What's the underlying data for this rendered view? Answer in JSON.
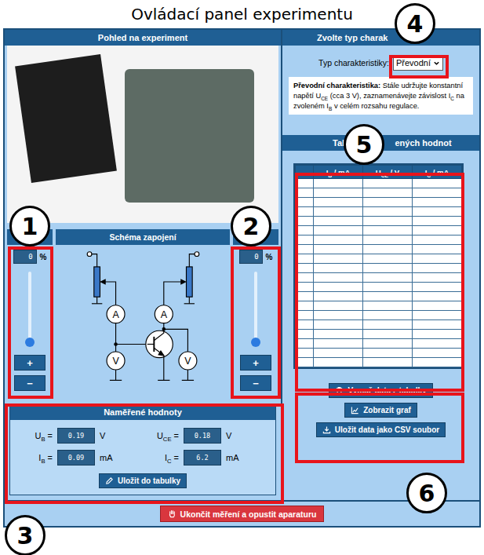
{
  "window": {
    "title": "Ovládací panel experimentu"
  },
  "left": {
    "photo_panel": {
      "title": "Pohled na experiment"
    },
    "schematic": {
      "title": "Schéma zapojení",
      "ammeter_label": "A",
      "voltmeter_label": "V"
    },
    "sliders": [
      {
        "value": "0",
        "unit": "%",
        "level": 0,
        "plus": "+",
        "minus": "−"
      },
      {
        "value": "0",
        "unit": "%",
        "level": 0,
        "plus": "+",
        "minus": "−"
      }
    ],
    "measured": {
      "title": "Naměřené hodnoty",
      "values": [
        {
          "symbol": "U",
          "sub": "B",
          "sign": "=",
          "value": "0.19",
          "unit": "V"
        },
        {
          "symbol": "U",
          "sub": "CE",
          "sign": "=",
          "value": "0.18",
          "unit": "V"
        },
        {
          "symbol": "I",
          "sub": "B",
          "sign": "=",
          "value": "0.09",
          "unit": "mA"
        },
        {
          "symbol": "I",
          "sub": "C",
          "sign": "=",
          "value": "6.2",
          "unit": "mA"
        }
      ],
      "save_button": "Uložit do tabulky"
    }
  },
  "right": {
    "type_panel": {
      "title": "Zvolte typ charak",
      "label": "Typ charakteristiky:",
      "selected": "Převodní",
      "description": {
        "title": "Převodní charakteristika:",
        "parts": [
          {
            "kind": "text",
            "text": "Stále udržujte konstantní napětí U"
          },
          {
            "kind": "sub",
            "text": "CE"
          },
          {
            "kind": "text",
            "text": " (cca 3 V), zaznamenávejte závislost I"
          },
          {
            "kind": "sub",
            "text": "C"
          },
          {
            "kind": "text",
            "text": " na zvoleném I"
          },
          {
            "kind": "sub",
            "text": "B"
          },
          {
            "kind": "text",
            "text": " v celém rozsahu regulace."
          }
        ]
      }
    },
    "table": {
      "title_start": "Tabu",
      "title_end": "ených hodnot",
      "columns": [
        {
          "symbol": "I",
          "sub": "B",
          "unit": "/ mA"
        },
        {
          "symbol": "U",
          "sub": "CE",
          "unit": "/ V"
        },
        {
          "symbol": "I",
          "sub": "C",
          "unit": "/ mA"
        }
      ],
      "rows": [
        [
          "",
          "",
          "",
          ""
        ],
        [
          "",
          "",
          "",
          ""
        ],
        [
          "",
          "",
          "",
          ""
        ],
        [
          "",
          "",
          "",
          ""
        ],
        [
          "",
          "",
          "",
          ""
        ],
        [
          "",
          "",
          "",
          ""
        ],
        [
          "",
          "",
          "",
          ""
        ],
        [
          "",
          "",
          "",
          ""
        ],
        [
          "",
          "",
          "",
          ""
        ],
        [
          "",
          "",
          "",
          ""
        ],
        [
          "",
          "",
          "",
          ""
        ],
        [
          "",
          "",
          "",
          ""
        ],
        [
          "",
          "",
          "",
          ""
        ],
        [
          "",
          "",
          "",
          ""
        ],
        [
          "",
          "",
          "",
          ""
        ],
        [
          "",
          "",
          "",
          ""
        ],
        [
          "",
          "",
          "",
          ""
        ],
        [
          "",
          "",
          "",
          ""
        ],
        [
          "",
          "",
          "",
          ""
        ],
        [
          "",
          "",
          "",
          ""
        ]
      ]
    },
    "buttons": [
      {
        "label": "Vymaž data z tabulky",
        "kind": "clear"
      },
      {
        "label": "Zobrazit graf",
        "kind": "graph"
      },
      {
        "label": "Uložit data jako CSV soubor",
        "kind": "export"
      }
    ]
  },
  "exit_button": "Ukončit měření a opustit aparaturu",
  "callouts": [
    "1",
    "2",
    "3",
    "4",
    "5",
    "6"
  ]
}
